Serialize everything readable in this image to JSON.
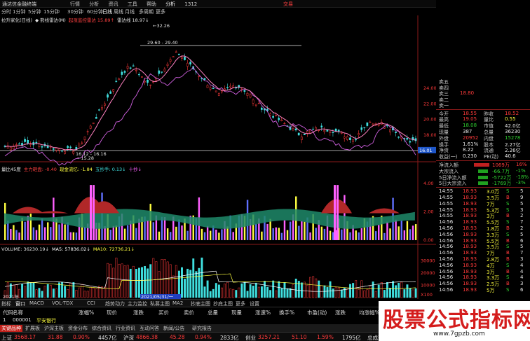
{
  "titlebar": {
    "app_name": "通达信金融终端",
    "menus": [
      "行情",
      "分析",
      "资讯",
      "工具",
      "帮助"
    ],
    "tab": "分析",
    "code": "1312",
    "trade_label": "交易",
    "win_min": "—",
    "win_max": "□",
    "win_close": "✕"
  },
  "periods": {
    "items": [
      "分时",
      "1分钟",
      "5分钟",
      "15分钟",
      "30分钟",
      "60分钟",
      "日线",
      "周线",
      "月线",
      "多周期",
      "更多"
    ],
    "active": "日线"
  },
  "main_header": {
    "items": [
      {
        "text": "拉升家化(日线)",
        "color": "#e0e0e0"
      },
      {
        "text": "◆ 熊线雷达(M)",
        "color": "#e0e0e0"
      },
      {
        "text": "起涨监控雷达 15.89↑",
        "color": "#ff4040"
      },
      {
        "text": "雷达线 18.97↓",
        "color": "#e0e0e0"
      }
    ],
    "annotations": {
      "high": "32.26",
      "range": "29.60 - 29.40",
      "low1": "16.12 - 16.16",
      "low2": "15.28"
    },
    "price_axis": [
      "24.00",
      "22.00",
      "20.00",
      "18.00",
      "16.00"
    ],
    "current_price": "16.01"
  },
  "indicator_header": {
    "items": [
      {
        "text": "量比45度",
        "color": "#e0e0e0"
      },
      {
        "text": "主力砸盘: -0.40",
        "color": "#ff4040"
      },
      {
        "text": "现金流忆: -1.84",
        "color": "#ffff40"
      },
      {
        "text": "五抄手: 0.13↓",
        "color": "#40e0e0"
      },
      {
        "text": "十抄↓",
        "color": "#ff60ff"
      }
    ],
    "axis": [
      "4.00",
      "2.00",
      "0.00"
    ]
  },
  "volume_header": {
    "items": [
      {
        "text": "VOLUME: 36230.19↓",
        "color": "#e0e0e0"
      },
      {
        "text": "MA5: 57836.02↓",
        "color": "#ffffff"
      },
      {
        "text": "MA10: 72736.21↓",
        "color": "#ffff40"
      }
    ],
    "axis": [
      "30000",
      "20000",
      "10000",
      "X100"
    ],
    "date_label": "2021/05/31/一",
    "year_label": "2021年"
  },
  "right_panel": {
    "stock_code": "1312",
    "order_book": [
      {
        "label": "卖五",
        "price": "",
        "vol": "",
        "color": "red"
      },
      {
        "label": "卖四",
        "price": "",
        "vol": "",
        "color": "red"
      },
      {
        "label": "卖三",
        "price": "18.80",
        "vol": "",
        "color": "red"
      },
      {
        "label": "卖二",
        "price": "",
        "vol": "",
        "color": "red"
      },
      {
        "label": "卖一",
        "price": "",
        "vol": "",
        "color": "red"
      }
    ],
    "quote": [
      {
        "l1": "今开",
        "v1": "18.55",
        "l2": "昨收",
        "v2": "18.52",
        "c1": "red",
        "c2": "red"
      },
      {
        "l1": "最高",
        "v1": "19.05",
        "l2": "量比",
        "v2": "0.55",
        "c1": "red",
        "c2": "yel"
      },
      {
        "l1": "最低",
        "v1": "18.08",
        "l2": "市值",
        "v2": "42.0亿",
        "c1": "grn",
        "c2": "wht"
      },
      {
        "l1": "现量",
        "v1": "387",
        "l2": "总量",
        "v2": "36230",
        "c1": "wht",
        "c2": "wht"
      },
      {
        "l1": "外盘",
        "v1": "20952",
        "l2": "内盘",
        "v2": "15278",
        "c1": "red",
        "c2": "grn"
      },
      {
        "l1": "换手",
        "v1": "1.61%",
        "l2": "股本",
        "v2": "2.27亿",
        "c1": "wht",
        "c2": "wht"
      },
      {
        "l1": "净资",
        "v1": "8.22",
        "l2": "流通",
        "v2": "2.26亿",
        "c1": "wht",
        "c2": "wht"
      },
      {
        "l1": "收益(一)",
        "v1": "0.230",
        "l2": "PE(动)",
        "v2": "40.6",
        "c1": "wht",
        "c2": "wht"
      }
    ],
    "flows": [
      {
        "label": "净流入额",
        "value": "1069万",
        "pct": "16%",
        "color": "red"
      },
      {
        "label": "大宗流入",
        "value": "-66.7万",
        "pct": "-1%",
        "color": "grn"
      },
      {
        "label": "5日净流入额",
        "value": "-5722万",
        "pct": "-18%",
        "color": "grn"
      },
      {
        "label": "5日大宗流入",
        "value": "-1769万",
        "pct": "-3%",
        "color": "grn"
      }
    ],
    "ticks": [
      {
        "time": "14:55",
        "price": "18.93",
        "vol": "3.0万",
        "dir": "S",
        "n": "5"
      },
      {
        "time": "14:55",
        "price": "18.93",
        "vol": "3.5万",
        "dir": "B",
        "n": "9"
      },
      {
        "time": "14:55",
        "price": "18.93",
        "vol": "7万",
        "dir": "S",
        "n": "5"
      },
      {
        "time": "14:55",
        "price": "18.93",
        "vol": "5.3万",
        "dir": "S",
        "n": "3"
      },
      {
        "time": "14:55",
        "price": "18.93",
        "vol": "3万",
        "dir": "B",
        "n": "2"
      },
      {
        "time": "14:56",
        "price": "18.93",
        "vol": "5.5万",
        "dir": "S",
        "n": "7"
      },
      {
        "time": "14:56",
        "price": "18.93",
        "vol": "1.8万",
        "dir": "B",
        "n": "2"
      },
      {
        "time": "14:56",
        "price": "18.93",
        "vol": "3.3万",
        "dir": "S",
        "n": "5"
      },
      {
        "time": "14:56",
        "price": "18.93",
        "vol": "5.5万",
        "dir": "B",
        "n": "6"
      },
      {
        "time": "14:56",
        "price": "18.93",
        "vol": "3.5万",
        "dir": "S",
        "n": "5"
      },
      {
        "time": "14:56",
        "price": "18.93",
        "vol": "7万",
        "dir": "B",
        "n": "7"
      },
      {
        "time": "14:56",
        "price": "18.93",
        "vol": "2.8万",
        "dir": "B",
        "n": "3"
      },
      {
        "time": "14:56",
        "price": "18.93",
        "vol": "4万",
        "dir": "S",
        "n": "4"
      },
      {
        "time": "14:56",
        "price": "18.93",
        "vol": "3万",
        "dir": "B",
        "n": "4"
      },
      {
        "time": "14:56",
        "price": "18.93",
        "vol": "3.3万",
        "dir": "S",
        "n": "4"
      },
      {
        "time": "14:56",
        "price": "18.93",
        "vol": "2.5万",
        "dir": "B",
        "n": "3"
      },
      {
        "time": "14:56",
        "price": "18.93",
        "vol": "5万",
        "dir": "S",
        "n": "6"
      },
      {
        "time": "14:56",
        "price": "18.93",
        "vol": "3.3万",
        "dir": "S",
        "n": "3"
      },
      {
        "time": "14:56",
        "price": "18.93",
        "vol": "3.5万",
        "dir": "B",
        "n": "4"
      },
      {
        "time": "14:56",
        "price": "18.93",
        "vol": "3.3万",
        "dir": "S",
        "n": "5"
      },
      {
        "time": "14:56",
        "price": "18.93",
        "vol": "3万",
        "dir": "B",
        "n": "4"
      },
      {
        "time": "14:56",
        "price": "18.93",
        "vol": "5.1万",
        "dir": "S",
        "n": "6"
      },
      {
        "time": "14:57",
        "price": "18.93",
        "vol": "3.5万",
        "dir": "B",
        "n": "5"
      },
      {
        "time": "14:57",
        "price": "18.93",
        "vol": "4万",
        "dir": "S",
        "n": "4"
      }
    ]
  },
  "indicator_tabs": {
    "items": [
      "指标",
      "窗口",
      "MACD",
      "VOL-TDX",
      "CCI",
      "趋势动力",
      "主力监控",
      "私募主图",
      "MA2",
      "抄底主图",
      "抄底主图",
      "更多",
      "设置"
    ],
    "active": "窗口"
  },
  "columns": [
    "代码",
    "名称",
    "涨幅%",
    "现价",
    "涨跌",
    "买价",
    "卖价",
    "总量",
    "现量",
    "涨速%",
    "换手%",
    "市盈(动)",
    "涨跌",
    "均涨幅%",
    "涨停数",
    "买价",
    "卖价",
    "涨跌数"
  ],
  "first_row": {
    "index": "1",
    "code": "000001",
    "name": "平安银行",
    "values": [
      "",
      "",
      "",
      "",
      "",
      ""
    ]
  },
  "bottom_tabs": {
    "items": [
      "关键品种",
      "扩展板",
      "A股",
      "中小",
      "创业",
      "科创",
      "B股",
      "基金",
      "债券",
      "股转",
      "板块指数",
      "港美联动",
      "自定",
      "港股",
      "期货",
      "美股",
      "更多"
    ],
    "hot": "关键品种",
    "extra": [
      "沪深主板",
      "资金分布",
      "综合资讯",
      "行业资讯",
      "互动问答",
      "新闻/公告",
      "研究报告"
    ]
  },
  "statusbar": {
    "items": [
      {
        "text": "上证",
        "color": "#e0e0e0"
      },
      {
        "text": "3568.17",
        "color": "#ff3a3a"
      },
      {
        "text": "31.88",
        "color": "#ff3a3a"
      },
      {
        "text": "0.90%",
        "color": "#ff3a3a"
      },
      {
        "text": "4457亿",
        "color": "#e0e0e0"
      },
      {
        "text": "沪深",
        "color": "#e0e0e0"
      },
      {
        "text": "4866.38",
        "color": "#ff3a3a"
      },
      {
        "text": "45.28",
        "color": "#ff3a3a"
      },
      {
        "text": "0.94%",
        "color": "#ff3a3a"
      },
      {
        "text": "2833亿",
        "color": "#e0e0e0"
      },
      {
        "text": "创业",
        "color": "#e0e0e0"
      },
      {
        "text": "3257.21",
        "color": "#ff3a3a"
      },
      {
        "text": "51.10",
        "color": "#ff3a3a"
      },
      {
        "text": "1.59%",
        "color": "#ff3a3a"
      },
      {
        "text": "1795亿",
        "color": "#e0e0e0"
      },
      {
        "text": "总成交",
        "color": "#e0e0e0"
      },
      {
        "text": "9504亿",
        "color": "#ffff40"
      },
      {
        "text": "平安证券上海",
        "color": "#e0e0e0"
      }
    ]
  },
  "watermark": {
    "title": "股票公式指标网",
    "url": "www.7gpzb.com"
  },
  "colors": {
    "up": "#ff3a3a",
    "down": "#40e0e0",
    "accent_yellow": "#ffff40",
    "accent_magenta": "#ff60ff"
  },
  "icons": [
    "app-logo-icon",
    "minimize-icon",
    "maximize-icon",
    "close-icon"
  ]
}
